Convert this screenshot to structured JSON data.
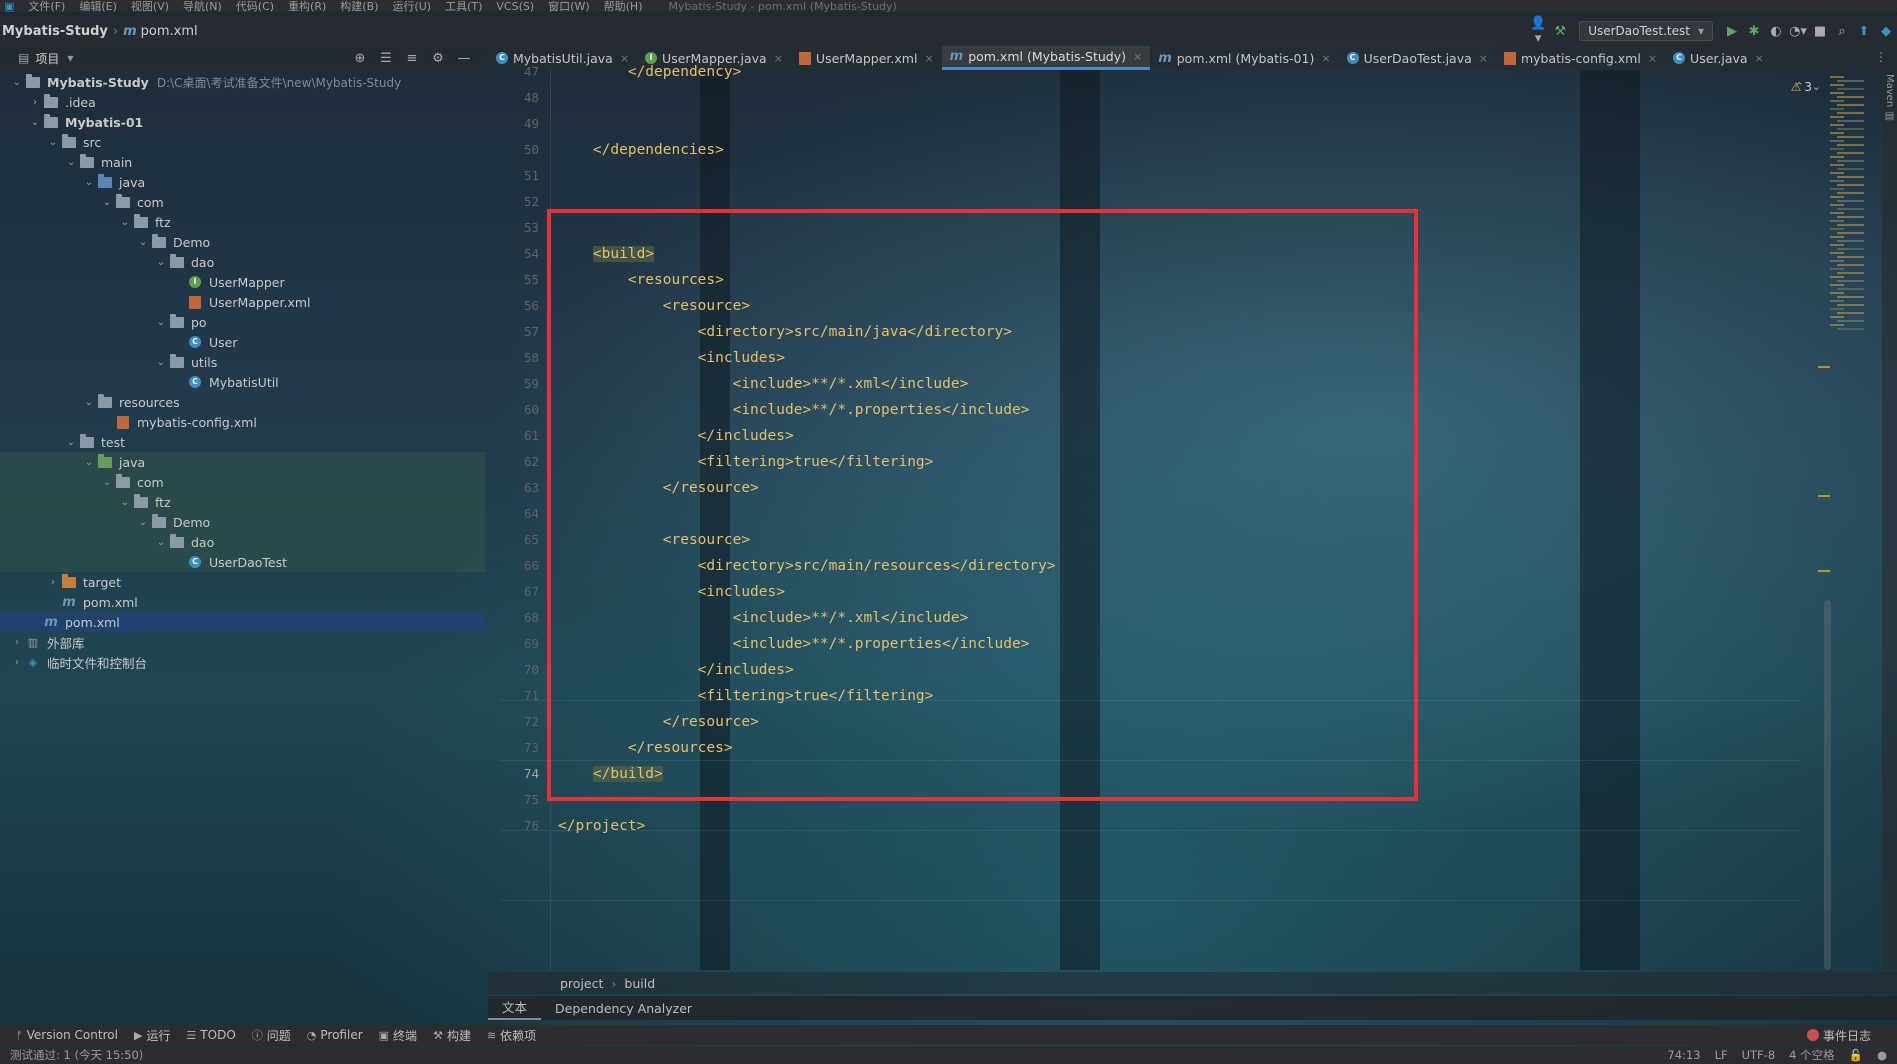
{
  "menu": {
    "items": [
      "文件(F)",
      "编辑(E)",
      "视图(V)",
      "导航(N)",
      "代码(C)",
      "重构(R)",
      "构建(B)",
      "运行(U)",
      "工具(T)",
      "VCS(S)",
      "窗口(W)",
      "帮助(H)"
    ],
    "window_title": "Mybatis-Study - pom.xml (Mybatis-Study)"
  },
  "navbar": {
    "project": "Mybatis-Study",
    "file_icon": "m",
    "file": "pom.xml",
    "run_config": "UserDaoTest.test"
  },
  "project_panel": {
    "title": "项目",
    "tree": [
      {
        "label": "Mybatis-Study",
        "path": "D:\\C桌面\\考试准备文件\\new\\Mybatis-Study",
        "icon": "folder-module",
        "indent": 0,
        "arrow": "open",
        "bold": true
      },
      {
        "label": ".idea",
        "icon": "folder",
        "indent": 1,
        "arrow": "closed"
      },
      {
        "label": "Mybatis-01",
        "icon": "folder-module",
        "indent": 1,
        "arrow": "open",
        "bold": true
      },
      {
        "label": "src",
        "icon": "folder",
        "indent": 2,
        "arrow": "open"
      },
      {
        "label": "main",
        "icon": "folder",
        "indent": 3,
        "arrow": "open"
      },
      {
        "label": "java",
        "icon": "folder-blue",
        "indent": 4,
        "arrow": "open"
      },
      {
        "label": "com",
        "icon": "folder",
        "indent": 5,
        "arrow": "open"
      },
      {
        "label": "ftz",
        "icon": "folder",
        "indent": 6,
        "arrow": "open"
      },
      {
        "label": "Demo",
        "icon": "folder",
        "indent": 7,
        "arrow": "open"
      },
      {
        "label": "dao",
        "icon": "folder",
        "indent": 8,
        "arrow": "open"
      },
      {
        "label": "UserMapper",
        "icon": "interface",
        "indent": 9,
        "arrow": "none"
      },
      {
        "label": "UserMapper.xml",
        "icon": "xml",
        "indent": 9,
        "arrow": "none"
      },
      {
        "label": "po",
        "icon": "folder",
        "indent": 8,
        "arrow": "open"
      },
      {
        "label": "User",
        "icon": "class",
        "indent": 9,
        "arrow": "none"
      },
      {
        "label": "utils",
        "icon": "folder",
        "indent": 8,
        "arrow": "open"
      },
      {
        "label": "MybatisUtil",
        "icon": "class",
        "indent": 9,
        "arrow": "none"
      },
      {
        "label": "resources",
        "icon": "folder-res",
        "indent": 4,
        "arrow": "open"
      },
      {
        "label": "mybatis-config.xml",
        "icon": "xml",
        "indent": 5,
        "arrow": "none"
      },
      {
        "label": "test",
        "icon": "folder",
        "indent": 3,
        "arrow": "open"
      },
      {
        "label": "java",
        "icon": "folder-green",
        "indent": 4,
        "arrow": "open",
        "highlight": true
      },
      {
        "label": "com",
        "icon": "folder",
        "indent": 5,
        "arrow": "open",
        "highlight": true
      },
      {
        "label": "ftz",
        "icon": "folder",
        "indent": 6,
        "arrow": "open",
        "highlight": true
      },
      {
        "label": "Demo",
        "icon": "folder",
        "indent": 7,
        "arrow": "open",
        "highlight": true
      },
      {
        "label": "dao",
        "icon": "folder",
        "indent": 8,
        "arrow": "open",
        "highlight": true
      },
      {
        "label": "UserDaoTest",
        "icon": "class",
        "indent": 9,
        "arrow": "none",
        "highlight": true
      },
      {
        "label": "target",
        "icon": "folder-orange",
        "indent": 2,
        "arrow": "closed"
      },
      {
        "label": "pom.xml",
        "icon": "maven",
        "indent": 2,
        "arrow": "none"
      },
      {
        "label": "pom.xml",
        "icon": "maven",
        "indent": 1,
        "arrow": "none",
        "selected": true
      },
      {
        "label": "外部库",
        "icon": "library",
        "indent": 0,
        "arrow": "closed"
      },
      {
        "label": "临时文件和控制台",
        "icon": "scratch",
        "indent": 0,
        "arrow": "closed"
      }
    ]
  },
  "tabs": [
    {
      "label": "MybatisUtil.java",
      "icon": "class",
      "active": false
    },
    {
      "label": "UserMapper.java",
      "icon": "interface",
      "active": false
    },
    {
      "label": "UserMapper.xml",
      "icon": "xml",
      "active": false
    },
    {
      "label": "pom.xml (Mybatis-Study)",
      "icon": "maven",
      "active": true
    },
    {
      "label": "pom.xml (Mybatis-01)",
      "icon": "maven",
      "active": false
    },
    {
      "label": "UserDaoTest.java",
      "icon": "class",
      "active": false
    },
    {
      "label": "mybatis-config.xml",
      "icon": "xml",
      "active": false
    },
    {
      "label": "User.java",
      "icon": "class",
      "active": false
    }
  ],
  "editor": {
    "warnings": "3",
    "lines": [
      {
        "num": "47",
        "code": "        </dependency>"
      },
      {
        "num": "48",
        "code": ""
      },
      {
        "num": "49",
        "code": ""
      },
      {
        "num": "50",
        "code": "    </dependencies>"
      },
      {
        "num": "51",
        "code": ""
      },
      {
        "num": "52",
        "code": ""
      },
      {
        "num": "53",
        "code": ""
      },
      {
        "num": "54",
        "code": "    <build>"
      },
      {
        "num": "55",
        "code": "        <resources>"
      },
      {
        "num": "56",
        "code": "            <resource>"
      },
      {
        "num": "57",
        "code": "                <directory>src/main/java</directory>"
      },
      {
        "num": "58",
        "code": "                <includes>"
      },
      {
        "num": "59",
        "code": "                    <include>**/*.xml</include>"
      },
      {
        "num": "60",
        "code": "                    <include>**/*.properties</include>"
      },
      {
        "num": "61",
        "code": "                </includes>"
      },
      {
        "num": "62",
        "code": "                <filtering>true</filtering>"
      },
      {
        "num": "63",
        "code": "            </resource>"
      },
      {
        "num": "64",
        "code": ""
      },
      {
        "num": "65",
        "code": "            <resource>"
      },
      {
        "num": "66",
        "code": "                <directory>src/main/resources</directory>"
      },
      {
        "num": "67",
        "code": "                <includes>"
      },
      {
        "num": "68",
        "code": "                    <include>**/*.xml</include>"
      },
      {
        "num": "69",
        "code": "                    <include>**/*.properties</include>"
      },
      {
        "num": "70",
        "code": "                </includes>"
      },
      {
        "num": "71",
        "code": "                <filtering>true</filtering>"
      },
      {
        "num": "72",
        "code": "            </resource>"
      },
      {
        "num": "73",
        "code": "        </resources>"
      },
      {
        "num": "74",
        "code": "    </build>"
      },
      {
        "num": "75",
        "code": ""
      },
      {
        "num": "76",
        "code": "</project>"
      }
    ],
    "current_line": "74",
    "highlight_color": "#e8303a"
  },
  "breadcrumb": {
    "items": [
      "project",
      "build"
    ]
  },
  "bottom_tabs": {
    "text": "文本",
    "analyzer": "Dependency Analyzer"
  },
  "tool_windows": [
    {
      "icon": "branch",
      "label": "Version Control"
    },
    {
      "icon": "play",
      "label": "运行"
    },
    {
      "icon": "list",
      "label": "TODO"
    },
    {
      "icon": "info",
      "label": "问题"
    },
    {
      "icon": "profiler",
      "label": "Profiler"
    },
    {
      "icon": "terminal",
      "label": "终端"
    },
    {
      "icon": "hammer",
      "label": "构建"
    },
    {
      "icon": "layers",
      "label": "依赖项"
    }
  ],
  "event_log": "事件日志",
  "status": {
    "message": "测试通过: 1 (今天 15:50)",
    "position": "74:13",
    "line_sep": "LF",
    "encoding": "UTF-8",
    "indent": "4 个空格"
  },
  "colors": {
    "accent": "#4a88c7",
    "tag": "#e8bf6a",
    "text": "#d4d4d4"
  }
}
